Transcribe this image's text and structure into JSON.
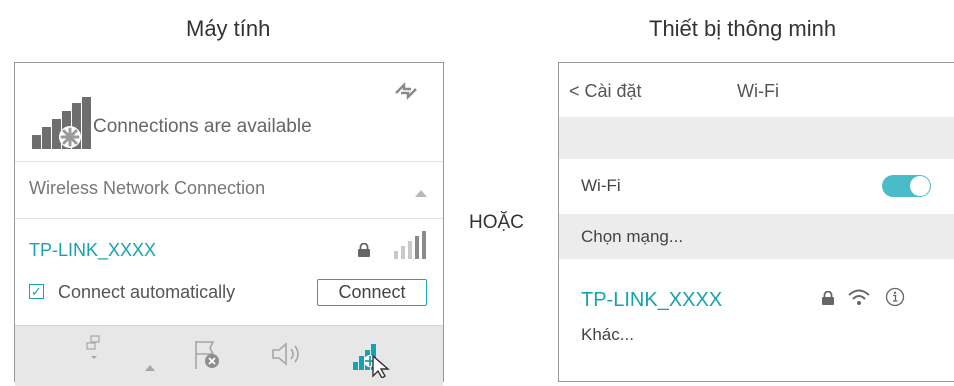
{
  "headings": {
    "computer": "Máy tính",
    "smart_device": "Thiết bị thông minh"
  },
  "separator_text": "HOẶC",
  "windows_flyout": {
    "status_text": "Connections are available",
    "section_title": "Wireless Network Connection",
    "network": {
      "ssid": "TP-LINK_XXXX",
      "connect_automatically_label": "Connect automatically",
      "connect_automatically_checked": true,
      "connect_button": "Connect"
    },
    "taskbar_icons": [
      "network-icon",
      "flag-error-icon",
      "speaker-icon",
      "wifi-signal-icon"
    ]
  },
  "phone": {
    "back_label": "< Cài đặt",
    "title": "Wi-Fi",
    "wifi_row_label": "Wi-Fi",
    "wifi_enabled": true,
    "choose_network_label": "Chọn mạng...",
    "network": {
      "ssid": "TP-LINK_XXXX"
    },
    "other_label": "Khác..."
  },
  "colors": {
    "accent": "#16a3b1",
    "toggle_on": "#49bcc8",
    "band": "#ececec",
    "taskbar": "#e7e7e7"
  }
}
